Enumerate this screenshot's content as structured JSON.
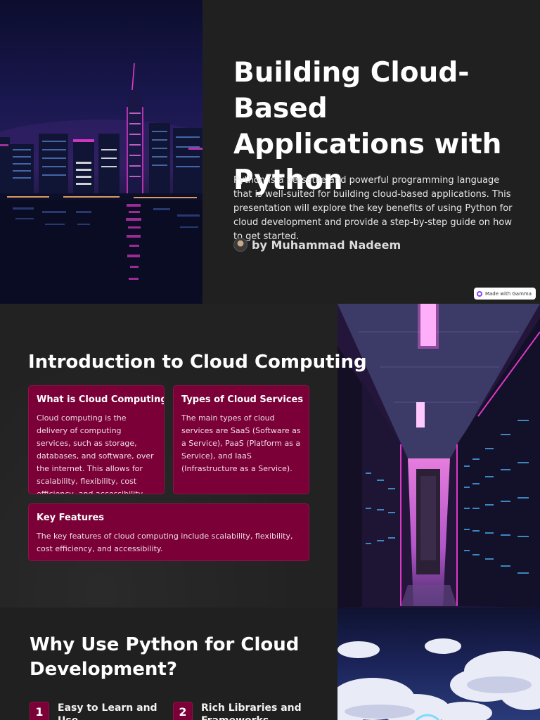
{
  "slide1": {
    "title": "Building Cloud-Based Applications with Python",
    "description": "Python is a versatile and powerful programming language that is well-suited for building cloud-based applications. This presentation will explore the key benefits of using Python for cloud development and provide a step-by-step guide on how to get started.",
    "author": "by Muhammad Nadeem",
    "badge": "Made with Gamma"
  },
  "slide2": {
    "title": "Introduction to Cloud Computing",
    "cards": [
      {
        "heading": "What is Cloud Computing?",
        "body": "Cloud computing is the delivery of computing services, such as storage, databases, and software, over the internet. This allows for scalability, flexibility, cost efficiency, and accessibility."
      },
      {
        "heading": "Types of Cloud Services",
        "body": "The main types of cloud services are SaaS (Software as a Service), PaaS (Platform as a Service), and IaaS (Infrastructure as a Service)."
      },
      {
        "heading": "Key Features",
        "body": "The key features of cloud computing include scalability, flexibility, cost efficiency, and accessibility."
      }
    ]
  },
  "slide3": {
    "title": "Why Use Python for Cloud Development?",
    "features": [
      {
        "number": "1",
        "label": "Easy to Learn and Use"
      },
      {
        "number": "2",
        "label": "Rich Libraries and Frameworks"
      }
    ]
  },
  "images": {
    "slide1_photo": "city-skyline-night-illustration",
    "slide2_photo": "server-room-illustration",
    "slide3_photo": "clouds-illustration"
  },
  "colors": {
    "background": "#202020",
    "card": "#7a0037",
    "neon_pink": "#ff2fd6"
  }
}
